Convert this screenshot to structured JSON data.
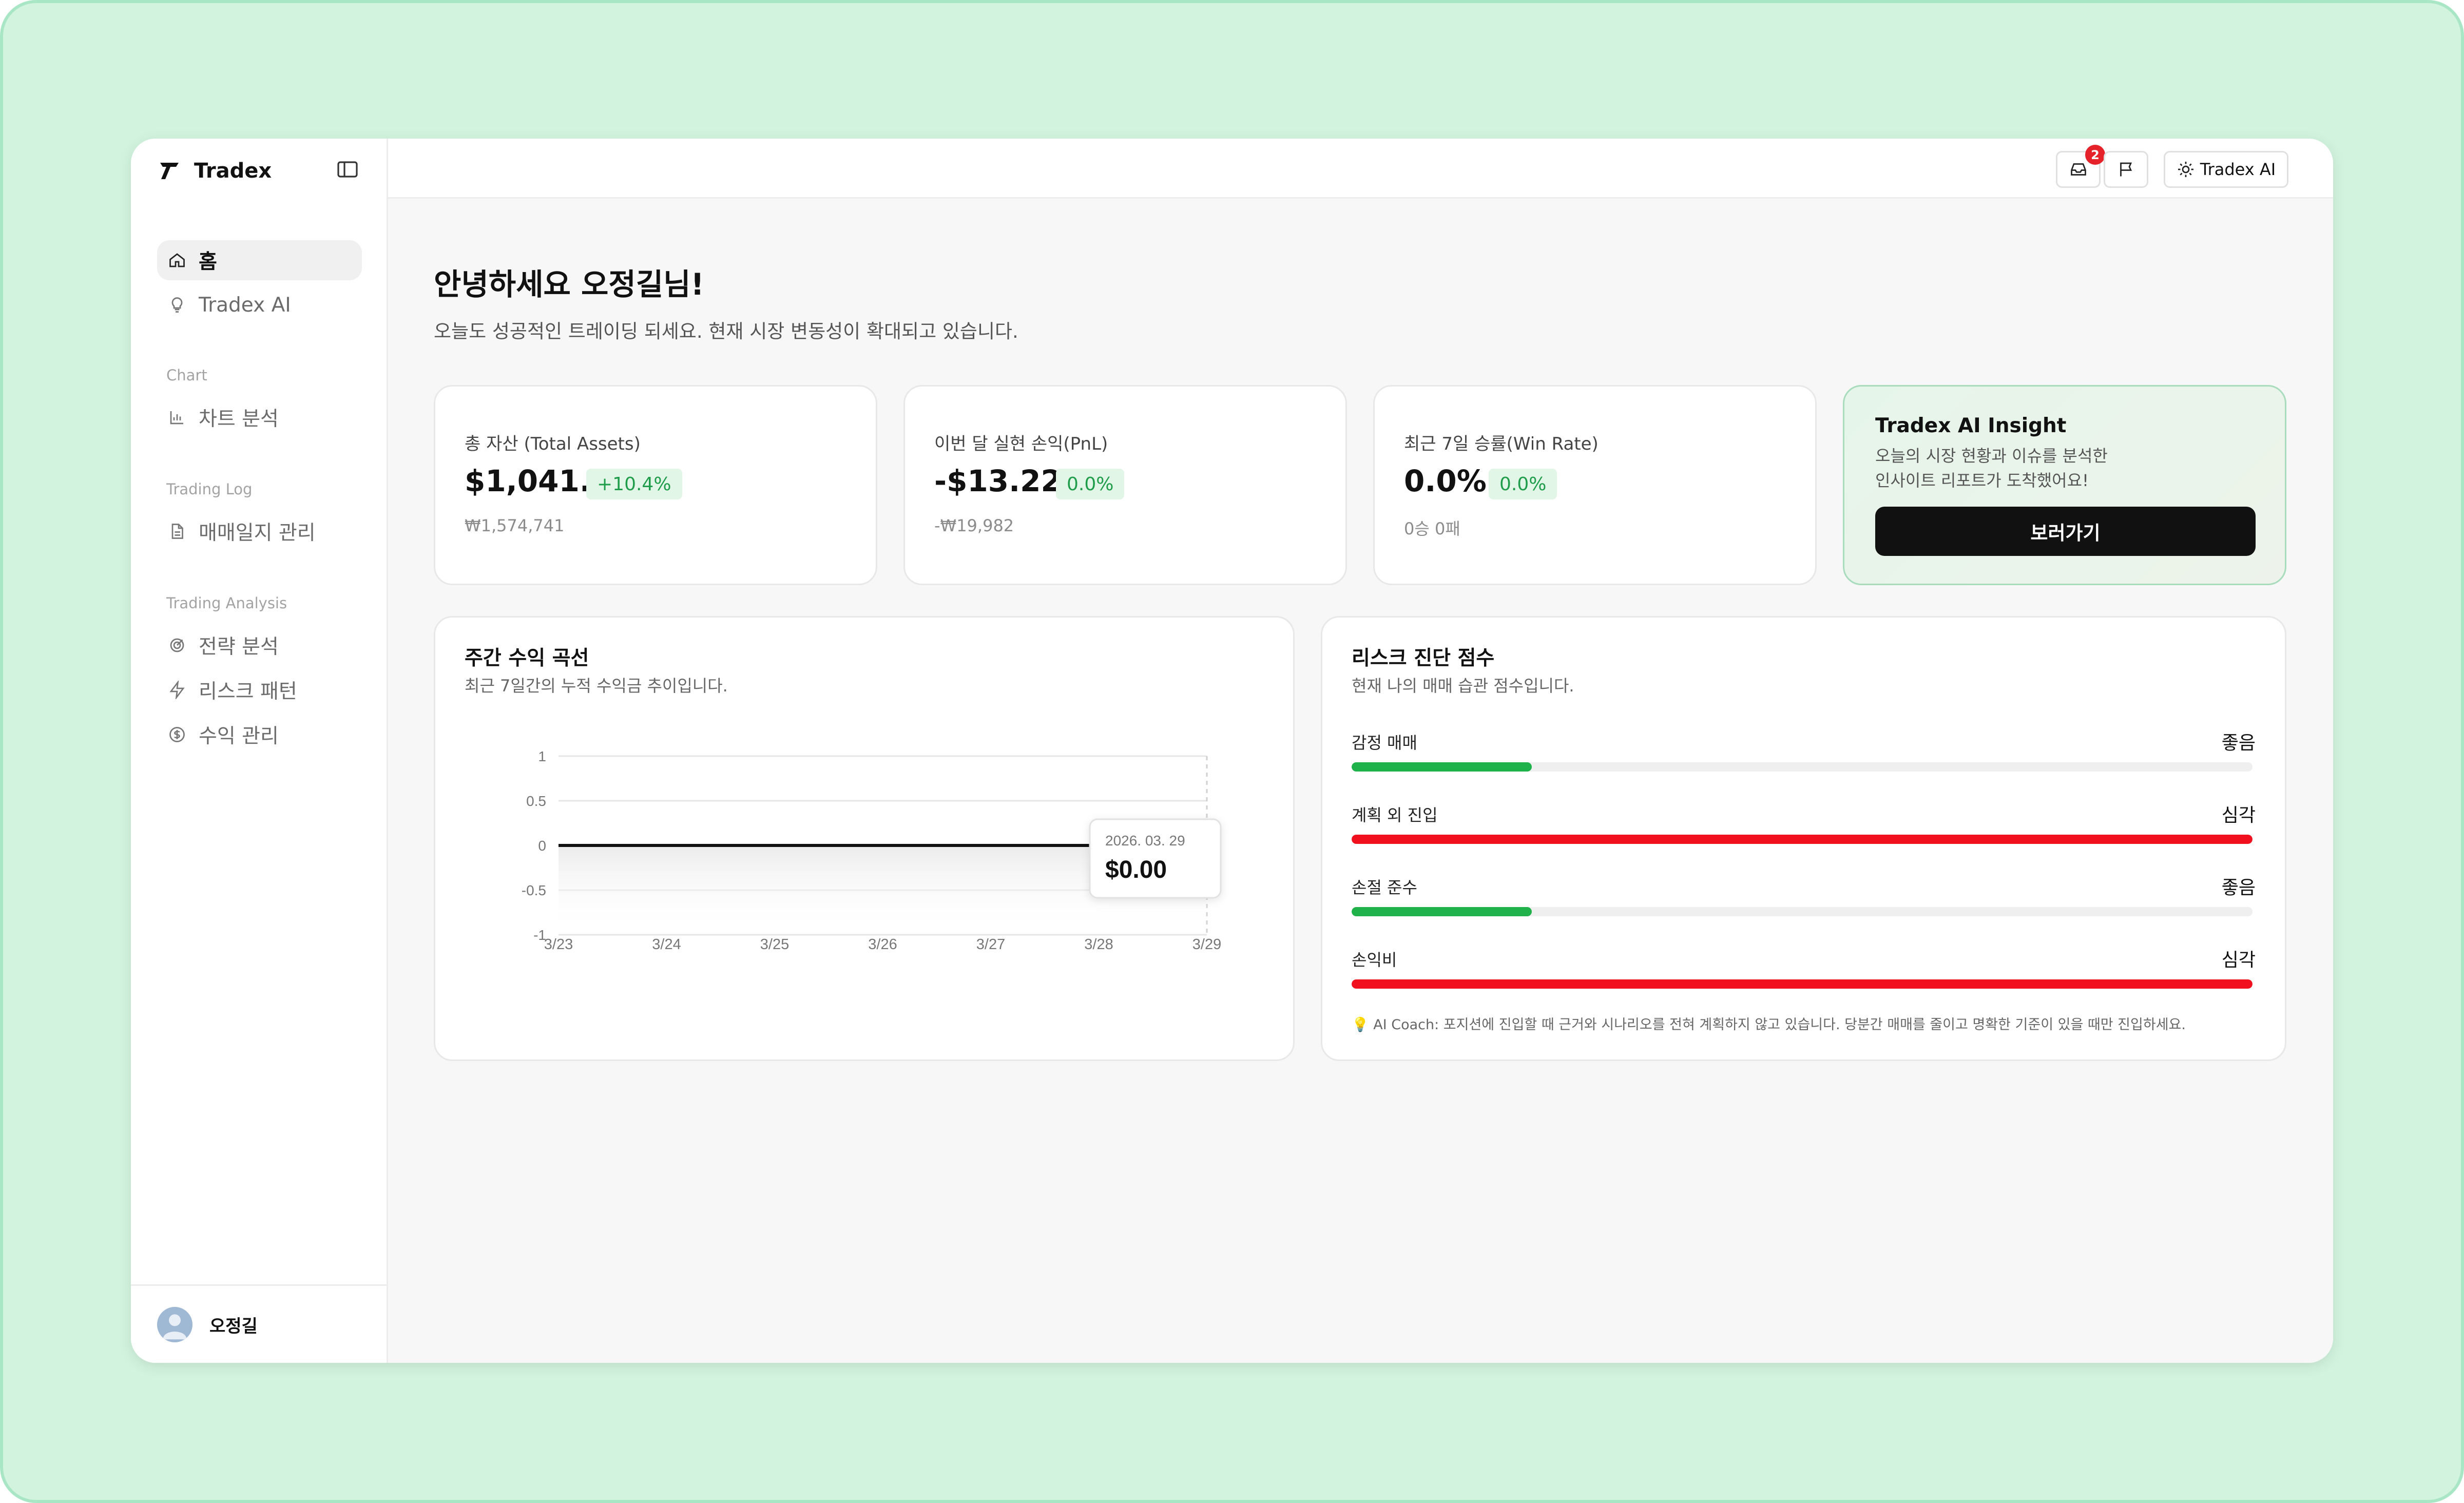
{
  "app": {
    "name": "Tradex"
  },
  "sidebar": {
    "items": [
      {
        "label": "홈",
        "icon": "home-icon",
        "active": true
      },
      {
        "label": "Tradex AI",
        "icon": "lightbulb-icon"
      },
      {
        "section": "Chart"
      },
      {
        "label": "차트 분석",
        "icon": "bar-chart-icon"
      },
      {
        "section": "Trading Log"
      },
      {
        "label": "매매일지 관리",
        "icon": "document-icon"
      },
      {
        "section": "Trading Analysis"
      },
      {
        "label": "전략 분석",
        "icon": "target-icon"
      },
      {
        "label": "리스크 패턴",
        "icon": "lightning-icon"
      },
      {
        "label": "수익 관리",
        "icon": "dollar-circle-icon"
      }
    ],
    "user": {
      "name": "오정길"
    }
  },
  "topbar": {
    "inbox_badge": "2",
    "ai_button": "Tradex AI"
  },
  "main": {
    "greeting": "안녕하세요 오정길님!",
    "subtitle": "오늘도 성공적인 트레이딩 되세요. 현재 시장 변동성이 확대되고 있습니다.",
    "stats": [
      {
        "label": "총 자산 (Total Assets)",
        "value": "$1,041.84",
        "change": "+10.4%",
        "sub": "₩1,574,741"
      },
      {
        "label": "이번 달 실현 손익(PnL)",
        "value": "-$13.22",
        "change": "0.0%",
        "sub": "-₩19,982"
      },
      {
        "label": "최근 7일 승률(Win Rate)",
        "value": "0.0%",
        "change": "0.0%",
        "sub": "0승 0패"
      }
    ],
    "insight": {
      "title": "Tradex AI Insight",
      "line1": "오늘의 시장 현황과 이슈를 분석한",
      "line2": "인사이트 리포트가 도착했어요!",
      "button": "보러가기"
    },
    "weekly_chart": {
      "title": "주간 수익 곡선",
      "subtitle": "최근 7일간의 누적 수익금 추이입니다.",
      "tooltip_date": "2026. 03. 29",
      "tooltip_value": "$0.00"
    },
    "risk": {
      "title": "리스크 진단 점수",
      "subtitle": "현재 나의 매매 습관 점수입니다.",
      "rows": [
        {
          "label": "감정 매매",
          "status": "좋음",
          "level": 0.2,
          "color": "#1fb24a"
        },
        {
          "label": "계획 외 진입",
          "status": "심각",
          "level": 1.0,
          "color": "#f0101e"
        },
        {
          "label": "손절 준수",
          "status": "좋음",
          "level": 0.2,
          "color": "#1fb24a"
        },
        {
          "label": "손익비",
          "status": "심각",
          "level": 1.0,
          "color": "#f0101e"
        }
      ],
      "coach": "AI Coach: 포지션에 진입할 때 근거와 시나리오를 전혀 계획하지 않고 있습니다. 당분간 매매를 줄이고 명확한 기준이 있을 때만 진입하세요."
    }
  },
  "chart_data": {
    "type": "line",
    "categories": [
      "3/23",
      "3/24",
      "3/25",
      "3/26",
      "3/27",
      "3/28",
      "3/29"
    ],
    "values": [
      0,
      0,
      0,
      0,
      0,
      0,
      0
    ],
    "y_ticks": [
      "1",
      "0.5",
      "0",
      "-0.5",
      "-1"
    ],
    "ylim": [
      -1,
      1
    ],
    "grid": true
  }
}
